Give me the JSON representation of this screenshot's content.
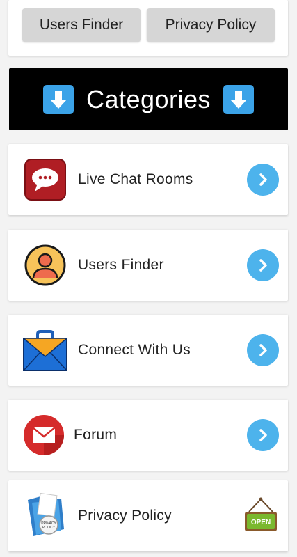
{
  "top_buttons": {
    "users_finder": "Users Finder",
    "privacy_policy": "Privacy Policy"
  },
  "categories_banner": {
    "title": "Categories",
    "left_icon": "down-arrow-icon",
    "right_icon": "down-arrow-icon"
  },
  "items": [
    {
      "label": "Live Chat Rooms",
      "icon": "chat-bubble-icon",
      "action_icon": "chevron-right-icon"
    },
    {
      "label": "Users Finder",
      "icon": "user-avatar-icon",
      "action_icon": "chevron-right-icon"
    },
    {
      "label": "Connect With Us",
      "icon": "mailbox-icon",
      "action_icon": "chevron-right-icon"
    },
    {
      "label": "Forum",
      "icon": "envelope-icon",
      "action_icon": "chevron-right-icon"
    },
    {
      "label": "Privacy Policy",
      "icon": "privacy-folder-icon",
      "action_icon": "open-sign-icon"
    }
  ],
  "privacy_folder_text": [
    "PRIVACY",
    "POLICY"
  ],
  "open_sign_text": "OPEN",
  "colors": {
    "banner_bg": "#000000",
    "arrow_blue": "#3ba3e8",
    "chevron_blue": "#4db3ec",
    "button_gray": "#d6d6d6"
  }
}
